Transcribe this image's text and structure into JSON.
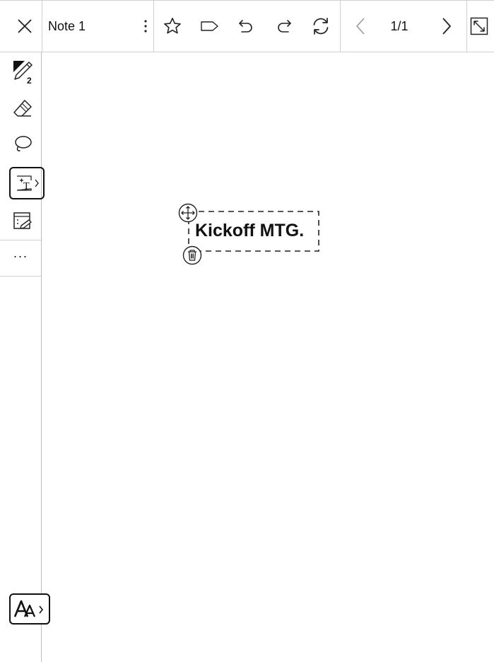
{
  "toolbar": {
    "close_icon": "close-icon",
    "note_title": "Note 1",
    "more_menu_icon": "vertical-ellipsis-icon",
    "actions": [
      "star-icon",
      "tag-icon",
      "undo-icon",
      "redo-icon",
      "sync-icon"
    ],
    "page_indicator": "1/1",
    "prev_icon": "chevron-left-icon",
    "next_icon": "chevron-right-icon",
    "expand_icon": "expand-icon"
  },
  "sidebar": {
    "pen_size_badge": "2",
    "tools": [
      "pen-icon",
      "eraser-icon",
      "lasso-icon",
      "text-box-icon",
      "template-icon"
    ],
    "selected_tool": "text-box-icon",
    "more_label": "···"
  },
  "canvas": {
    "text_box_content": "Kickoff MTG."
  },
  "font_button_icon": "font-size-icon"
}
